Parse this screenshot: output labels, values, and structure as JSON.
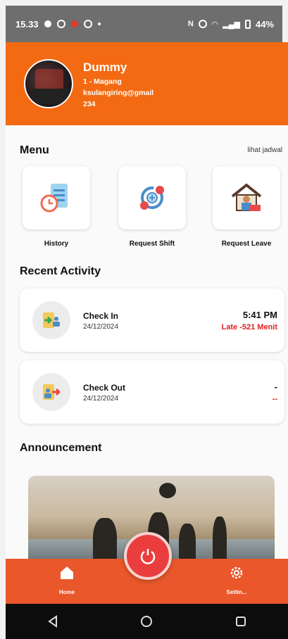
{
  "status_bar": {
    "time": "15.33",
    "battery": "44%"
  },
  "profile": {
    "name": "Dummy",
    "role": "1 - Magang",
    "email": "ksulangiring@gmail",
    "id": "234"
  },
  "menu": {
    "title": "Menu",
    "schedule_link": "lihat jadwal",
    "items": [
      {
        "label": "History",
        "icon": "history-icon"
      },
      {
        "label": "Request Shift",
        "icon": "request-shift-icon"
      },
      {
        "label": "Request Leave",
        "icon": "request-leave-icon"
      }
    ]
  },
  "recent_activity": {
    "title": "Recent Activity",
    "items": [
      {
        "title": "Check In",
        "date": "24/12/2024",
        "time": "5:41 PM",
        "status": "Late -521 Menit",
        "icon": "check-in-icon"
      },
      {
        "title": "Check Out",
        "date": "24/12/2024",
        "time": "-",
        "status": "--",
        "icon": "check-out-icon"
      }
    ]
  },
  "announcement": {
    "title": "Announcement"
  },
  "bottom_nav": {
    "items": [
      {
        "label": "Home",
        "icon": "home-icon"
      },
      {
        "label": "Settin...",
        "icon": "gear-icon"
      }
    ],
    "center_action": "power-icon"
  },
  "colors": {
    "header": "#f36a12",
    "navbar": "#e9572a",
    "late": "#e01f1f",
    "power": "#ea3e3e"
  }
}
